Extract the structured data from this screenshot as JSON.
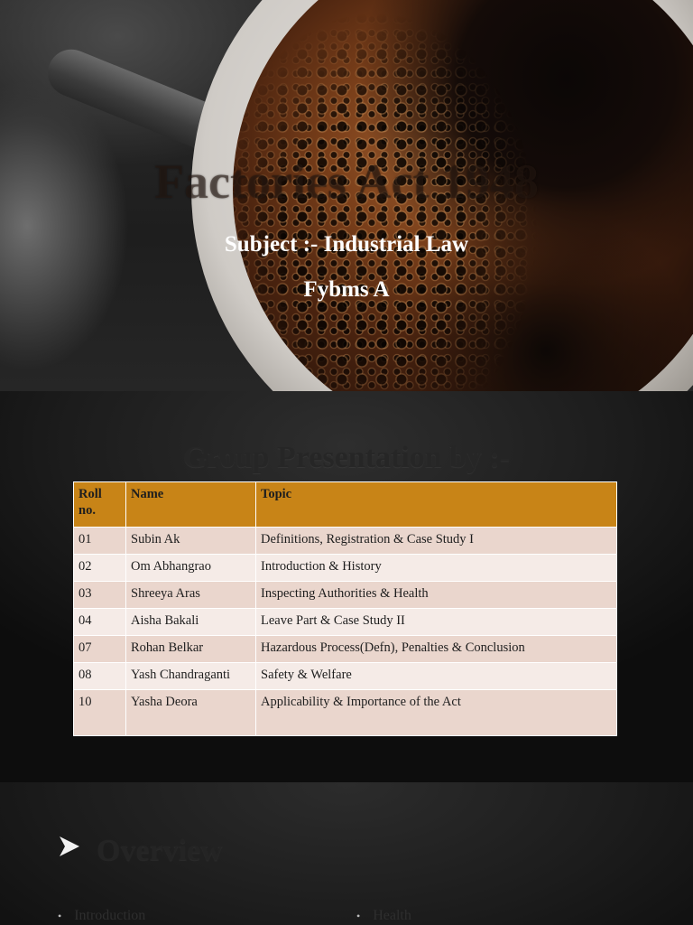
{
  "title_slide": {
    "title": "Factories Act 1948",
    "subject": "Subject :- Industrial Law",
    "class": "Fybms A"
  },
  "group_slide": {
    "title": "Group Presentation by :-",
    "table": {
      "headers": [
        "Roll no.",
        "Name",
        "Topic"
      ],
      "rows": [
        [
          "01",
          "Subin Ak",
          "Definitions, Registration & Case Study I"
        ],
        [
          "02",
          "Om Abhangrao",
          "Introduction & History"
        ],
        [
          "03",
          "Shreeya Aras",
          "Inspecting Authorities & Health"
        ],
        [
          "04",
          "Aisha Bakali",
          "Leave Part & Case Study II"
        ],
        [
          "07",
          "Rohan Belkar",
          "Hazardous Process(Defn), Penalties & Conclusion"
        ],
        [
          "08",
          "Yash Chandraganti",
          "Safety & Welfare"
        ],
        [
          "10",
          "Yasha Deora",
          "Applicability & Importance of the Act"
        ]
      ]
    }
  },
  "overview_slide": {
    "arrow_icon": "arrow-right-icon",
    "title": "Overview",
    "bullets": [
      "Introduction",
      "Health"
    ]
  },
  "colors": {
    "table_header": "#c88417",
    "table_row_odd": "#ead6cd",
    "table_row_even": "#f5ebe7",
    "title_text": "#ffffff"
  }
}
